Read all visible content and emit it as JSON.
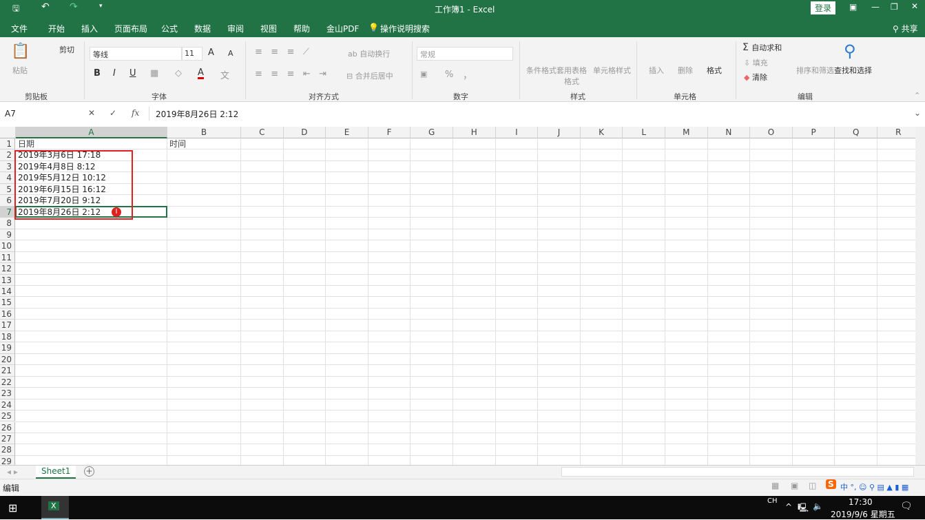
{
  "title_bar": {
    "title": "工作簿1  -  Excel",
    "login": "登录",
    "quick_access": [
      "save-icon",
      "undo-icon",
      "redo-icon",
      "customize-icon"
    ]
  },
  "menu": {
    "items": [
      "文件",
      "开始",
      "插入",
      "页面布局",
      "公式",
      "数据",
      "审阅",
      "视图",
      "帮助",
      "金山PDF"
    ],
    "tell_me": "操作说明搜索",
    "share": "共享"
  },
  "ribbon": {
    "clipboard": {
      "paste": "粘贴",
      "cut": "剪切",
      "group": "剪贴板"
    },
    "font": {
      "name": "等线",
      "size": "11",
      "group": "字体",
      "bold": "B",
      "italic": "I",
      "underline": "U",
      "font_color_letter": "A",
      "font_color": "#e00000"
    },
    "alignment": {
      "wrap": "自动换行",
      "merge": "合并后居中",
      "group": "对齐方式"
    },
    "number": {
      "format": "常规",
      "percent": "%",
      "comma": "，",
      "group": "数字"
    },
    "styles": {
      "conditional": "条件格式",
      "table": "套用表格格式",
      "cell_styles": "单元格样式",
      "group": "样式"
    },
    "cells": {
      "insert": "插入",
      "delete": "删除",
      "format": "格式",
      "group": "单元格"
    },
    "editing": {
      "autosum": "自动求和",
      "fill": "填充",
      "clear": "清除",
      "sort": "排序和筛选",
      "find": "查找和选择",
      "group": "编辑"
    }
  },
  "formula_bar": {
    "name_box": "A7",
    "fx": "fx",
    "value": "2019年8月26日 2:12"
  },
  "columns": [
    "A",
    "B",
    "C",
    "D",
    "E",
    "F",
    "G",
    "H",
    "I",
    "J",
    "K",
    "L",
    "M",
    "N",
    "O",
    "P",
    "Q",
    "R"
  ],
  "rows": 29,
  "cells": {
    "A1": "日期",
    "B1": "时间",
    "A2": "2019年3月6日 17:18",
    "A3": "2019年4月8日 8:12",
    "A4": "2019年5月12日 10:12",
    "A5": "2019年6月15日 16:12",
    "A6": "2019年7月20日 9:12",
    "A7": "2019年8月26日 2:12"
  },
  "active_cell": "A7",
  "sheet_tabs": [
    "Sheet1"
  ],
  "status_bar": {
    "mode": "编辑"
  },
  "taskbar": {
    "lang": "CH",
    "time": "17:30",
    "date": "2019/9/6 星期五"
  },
  "colors": {
    "excel_green": "#217346",
    "highlight_box": "#e02020"
  }
}
